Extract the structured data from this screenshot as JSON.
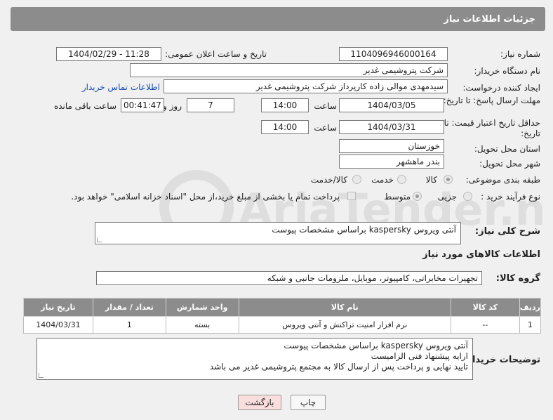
{
  "header": {
    "title": "جزئیات اطلاعات نیاز"
  },
  "fields": {
    "need_number": {
      "label": "شماره نیاز:",
      "value": "1104096946000164"
    },
    "announce_datetime": {
      "label": "تاریخ و ساعت اعلان عمومی:",
      "value": "1404/02/29 - 11:28"
    },
    "buyer_org": {
      "label": "نام دستگاه خریدار:",
      "value": "شرکت پتروشیمی غدیر"
    },
    "requester": {
      "label": "ایجاد کننده درخواست:",
      "value": "سیدمهدی موالی زاده کارپرداز شرکت پتروشیمی غدیر",
      "contact_link": "اطلاعات تماس خریدار"
    },
    "reply_deadline": {
      "label": "مهلت ارسال پاسخ: تا تاریخ:",
      "date": "1404/03/05",
      "time_label": "ساعت",
      "time": "14:00",
      "days": "7",
      "days_label": "روز و",
      "remaining": "00:41:47",
      "remaining_label": "ساعت باقی مانده"
    },
    "price_validity": {
      "label": "حداقل تاریخ اعتبار قیمت: تا تاریخ:",
      "date": "1404/03/31",
      "time_label": "ساعت",
      "time": "14:00"
    },
    "delivery_province": {
      "label": "استان محل تحویل:",
      "value": "خوزستان"
    },
    "delivery_city": {
      "label": "شهر محل تحویل:",
      "value": "بندر ماهشهر"
    },
    "category": {
      "label": "طبقه بندی موضوعی:",
      "options": [
        "کالا",
        "خدمت",
        "کالا/خدمت"
      ],
      "selected": "کالا"
    },
    "purchase_type": {
      "label": "نوع فرآیند خرید :",
      "options": [
        "جزیی",
        "متوسط"
      ],
      "selected": "متوسط",
      "payment_note": "پرداخت تمام یا بخشی از مبلغ خرید،از محل \"اسناد خزانه اسلامی\" خواهد بود."
    }
  },
  "description": {
    "label": "شرح کلی نیاز:",
    "value": "آنتی ویروس kaspersky براساس مشخصات پیوست"
  },
  "items_section": {
    "title": "اطلاعات کالاهای مورد نیاز",
    "group_label": "گروه کالا:",
    "group_value": "تجهیزات مخابراتی، کامپیوتر، موبایل، ملزومات جانبی و شبکه",
    "columns": [
      "ردیف",
      "کد کالا",
      "نام کالا",
      "واحد شمارش",
      "تعداد / مقدار",
      "تاریخ نیاز"
    ],
    "rows": [
      {
        "row": "1",
        "code": "--",
        "name": "نرم افزار امنیت تراکنش و آنتی ویروس",
        "unit": "بسته",
        "qty": "1",
        "date": "1404/03/31"
      }
    ]
  },
  "buyer_notes": {
    "label": "توضیحات خریدار:",
    "lines": [
      "آنتی ویروس kaspersky براساس مشخصات پیوست",
      "ارایه پیشنهاد فنی الزامیست",
      "تایید نهایی و پرداخت پس از ارسال کالا به مجتمع پتروشیمی غدیر می باشد"
    ]
  },
  "buttons": {
    "print": "چاپ",
    "back": "بازگشت"
  },
  "watermark": {
    "text": "AriaTender.neT"
  },
  "colors": {
    "header_bg": "#8c8c8c",
    "link": "#1a4fb0",
    "back_button_bg": "#fadede"
  }
}
